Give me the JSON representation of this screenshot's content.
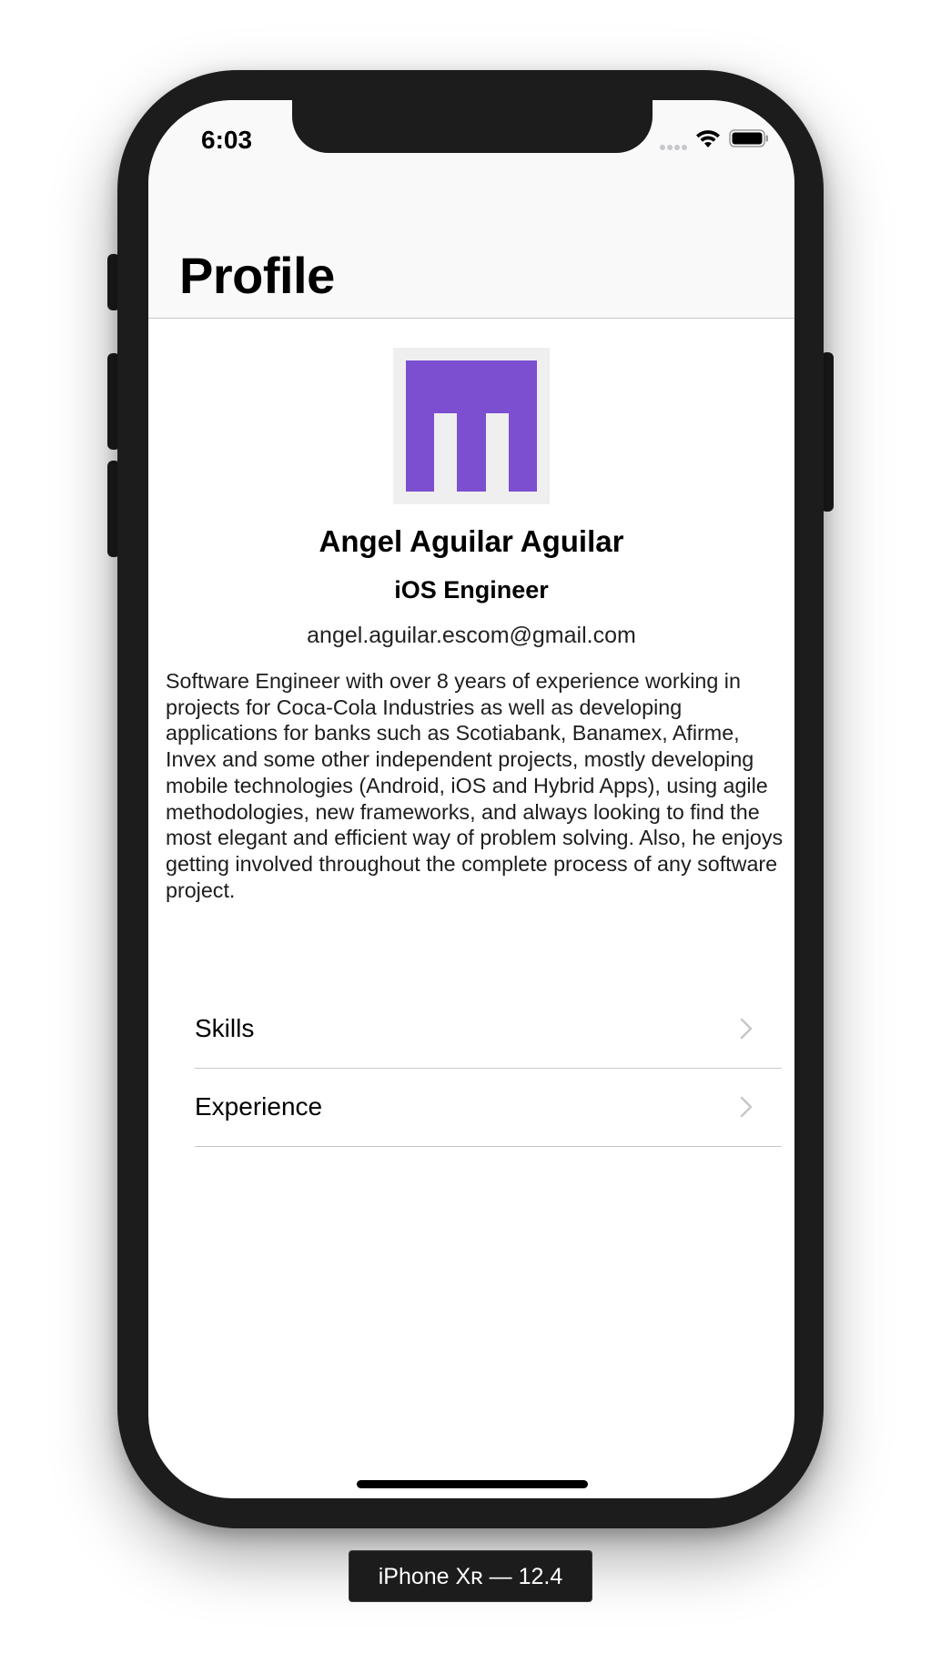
{
  "status_bar": {
    "time": "6:03"
  },
  "nav": {
    "title": "Profile"
  },
  "profile": {
    "name": "Angel Aguilar Aguilar",
    "role": "iOS Engineer",
    "email": "angel.aguilar.escom@gmail.com",
    "bio": "Software Engineer with over 8 years of experience working in projects for Coca-Cola Industries as well as developing applications for banks such as Scotiabank, Banamex, Afirme, Invex and some other independent projects, mostly developing mobile technologies (Android, iOS and Hybrid Apps), using agile methodologies, new frameworks, and always looking to find the most elegant and efficient way of problem solving. Also, he enjoys getting involved throughout the complete process of any software project."
  },
  "menu": {
    "items": [
      {
        "label": "Skills"
      },
      {
        "label": "Experience"
      }
    ]
  },
  "device_label": "iPhone Xʀ — 12.4",
  "colors": {
    "avatar_accent": "#7b4fd0",
    "avatar_background": "#efefef",
    "navbar_background": "#f9f9f9",
    "separator": "#c8c7cc",
    "chevron": "#c7c7cc"
  },
  "icons": {
    "avatar": "logo-m-avatar",
    "row_accessory": "chevron-right-icon",
    "status": [
      "cellular-signal-icon",
      "wifi-icon",
      "battery-icon"
    ]
  }
}
